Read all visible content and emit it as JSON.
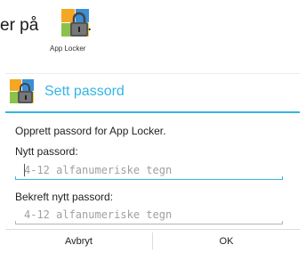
{
  "intro": {
    "text": "er på",
    "period": ".",
    "app_caption": "App Locker"
  },
  "dialog": {
    "title": "Sett passord",
    "description": "Opprett passord for App Locker.",
    "new_password": {
      "label": "Nytt passord:",
      "placeholder": "4-12 alfanumeriske tegn",
      "value": ""
    },
    "confirm_password": {
      "label": "Bekreft nytt passord:",
      "placeholder": "4-12 alfanumeriske tegn",
      "value": ""
    },
    "buttons": {
      "cancel": "Avbryt",
      "ok": "OK"
    }
  },
  "colors": {
    "accent": "#33b5e5",
    "icon_green": "#8bc34a",
    "icon_orange": "#f5a623",
    "icon_blue": "#3b8fd6",
    "icon_yellow": "#f7d23a"
  },
  "icons": {
    "app": "app-locker-icon",
    "dialog": "app-locker-icon"
  }
}
